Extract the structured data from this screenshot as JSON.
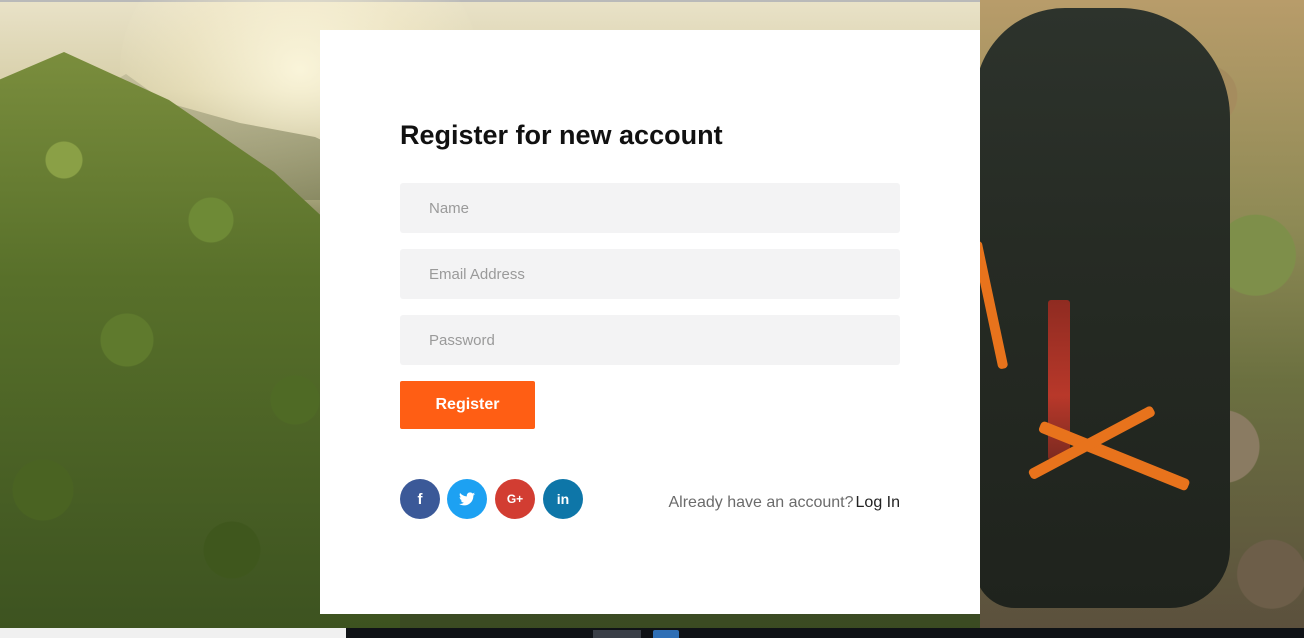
{
  "form": {
    "title": "Register for new account",
    "name_placeholder": "Name",
    "email_placeholder": "Email Address",
    "password_placeholder": "Password",
    "register_label": "Register"
  },
  "social": [
    {
      "network": "facebook",
      "icon": "facebook-icon",
      "glyph": "f",
      "color": "#3b5998"
    },
    {
      "network": "twitter",
      "icon": "twitter-icon",
      "glyph": "",
      "color": "#1da1f2"
    },
    {
      "network": "google-plus",
      "icon": "google-plus-icon",
      "glyph": "G+",
      "color": "#d23d32"
    },
    {
      "network": "linkedin",
      "icon": "linkedin-icon",
      "glyph": "in",
      "color": "#0e76a8"
    }
  ],
  "login": {
    "prompt": "Already have an account?",
    "link_label": "Log In"
  },
  "colors": {
    "accent": "#ff5e14",
    "field_background": "#f3f3f4",
    "card_background": "#ffffff"
  }
}
